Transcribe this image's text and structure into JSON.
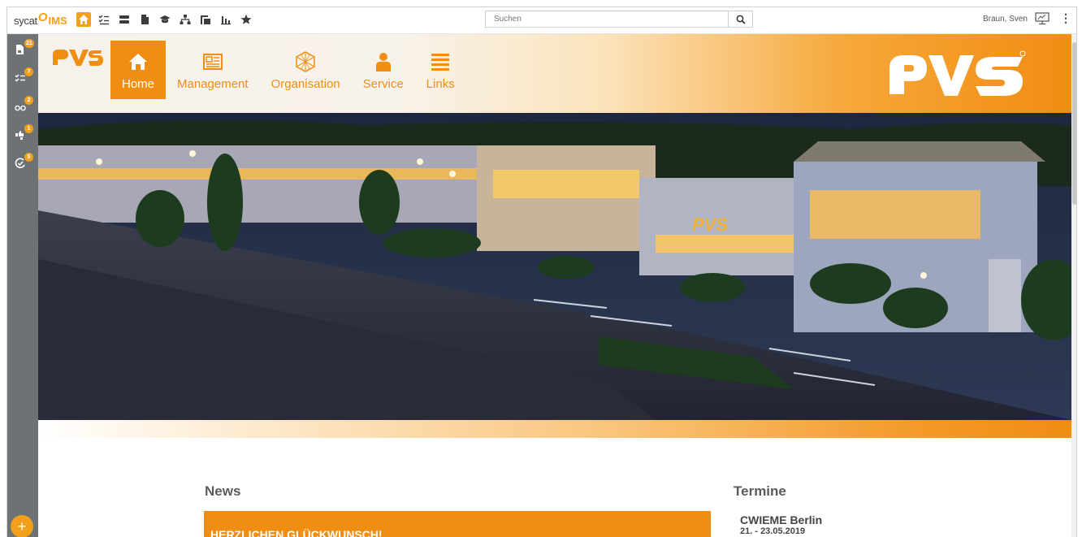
{
  "topbar": {
    "brand_prefix": "sycat",
    "brand_o": "O",
    "brand_suffix": "IMS",
    "icons": [
      "home-icon",
      "checklist-icon",
      "layers-icon",
      "document-icon",
      "graduation-cap-icon",
      "org-chart-icon",
      "copy-icon",
      "bar-chart-icon",
      "star-icon"
    ],
    "search_placeholder": "Suchen",
    "user_name": "Braun, Sven"
  },
  "sidebar": {
    "items": [
      {
        "name": "documents",
        "badge": "21"
      },
      {
        "name": "tasks",
        "badge": "7"
      },
      {
        "name": "review",
        "badge": "2"
      },
      {
        "name": "feedback",
        "badge": "1"
      },
      {
        "name": "acknowledge",
        "badge": "5"
      }
    ],
    "add_label": "+"
  },
  "header": {
    "nav": [
      {
        "label": "Home",
        "active": true
      },
      {
        "label": "Management",
        "active": false
      },
      {
        "label": "Organisation",
        "active": false
      },
      {
        "label": "Service",
        "active": false
      },
      {
        "label": "Links",
        "active": false
      }
    ]
  },
  "news": {
    "heading": "News",
    "card_title": "HERZLICHEN GLÜCKWUNSCH!"
  },
  "termine": {
    "heading": "Termine",
    "event_title": "CWIEME Berlin",
    "event_date": "21. - 23.05.2019"
  },
  "colors": {
    "accent": "#f08d13",
    "sidebar": "#6f7275"
  }
}
